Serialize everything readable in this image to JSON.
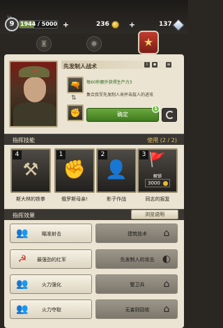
{
  "top_bar": {
    "level": "9",
    "level_prefix": "Lv",
    "xp": "1944 / 5000",
    "xp_fraction": 0.389,
    "gold": "236",
    "diamonds": "137",
    "plus": "+"
  },
  "tabs": [
    {
      "icon": "commander-emblem-icon",
      "glyph": "♜"
    },
    {
      "icon": "gear-emblem-icon",
      "glyph": "✸"
    },
    {
      "icon": "red-star-emblem-icon",
      "glyph": "★",
      "active": true
    }
  ],
  "commander": {
    "name": "先发制人战术",
    "slot1_glyph": "🔫",
    "slot2_glyph": "✊",
    "description": {
      "line1": "每60秒额外获得生产力3",
      "line2": "集合我军先发制人来抨击敌人的进攻"
    },
    "confirm_label": "确定",
    "confirm_badge": "1"
  },
  "skills_section": {
    "title": "指挥技能",
    "usage_label": "使用",
    "usage_count": "(2 / 2)"
  },
  "skills": [
    {
      "num": "4",
      "name": "斯大林的铁拳",
      "glyph": "⚒",
      "icon": "crossed-guns-icon"
    },
    {
      "num": "1",
      "name": "俄罗斯母亲!",
      "glyph": "✊",
      "icon": "raised-fist-icon"
    },
    {
      "num": "2",
      "name": "影子作战",
      "glyph": "👤",
      "icon": "shadow-soldier-icon"
    },
    {
      "num": "3",
      "name": "同志的报复",
      "glyph": "🚩",
      "icon": "comrade-revenge-icon",
      "unlock_label": "解锁",
      "unlock_cost": "3000"
    }
  ],
  "effects_section": {
    "title": "指挥效果",
    "rules_label": "浏览说明"
  },
  "effects": [
    {
      "label": "瞄准射击",
      "left_icon": "soldiers-icon",
      "left_glyph": "👥",
      "right_icon": "",
      "style": "light"
    },
    {
      "label": "建筑技术",
      "left_icon": "",
      "left_glyph": "",
      "right_icon": "house-icon",
      "right_glyph": "⌂",
      "style": "dark"
    },
    {
      "label": "最强劲的红军",
      "left_icon": "hammer-sickle-icon",
      "left_glyph": "☭",
      "right_icon": "",
      "style": "light"
    },
    {
      "label": "先发制人的攻击",
      "left_icon": "",
      "left_glyph": "",
      "right_icon": "eye-slash-icon",
      "right_glyph": "◐",
      "style": "dark"
    },
    {
      "label": "火力强化",
      "left_icon": "soldiers-icon",
      "left_glyph": "👥",
      "right_icon": "",
      "style": "light"
    },
    {
      "label": "警卫兵",
      "left_icon": "",
      "left_glyph": "",
      "right_icon": "house-icon",
      "right_glyph": "⌂",
      "style": "dark"
    },
    {
      "label": "火力夺取",
      "left_icon": "soldiers-icon",
      "left_glyph": "👥",
      "right_icon": "",
      "style": "light"
    },
    {
      "label": "无害则回收",
      "left_icon": "",
      "left_glyph": "",
      "right_icon": "house-icon",
      "right_glyph": "⌂",
      "style": "dark"
    }
  ]
}
